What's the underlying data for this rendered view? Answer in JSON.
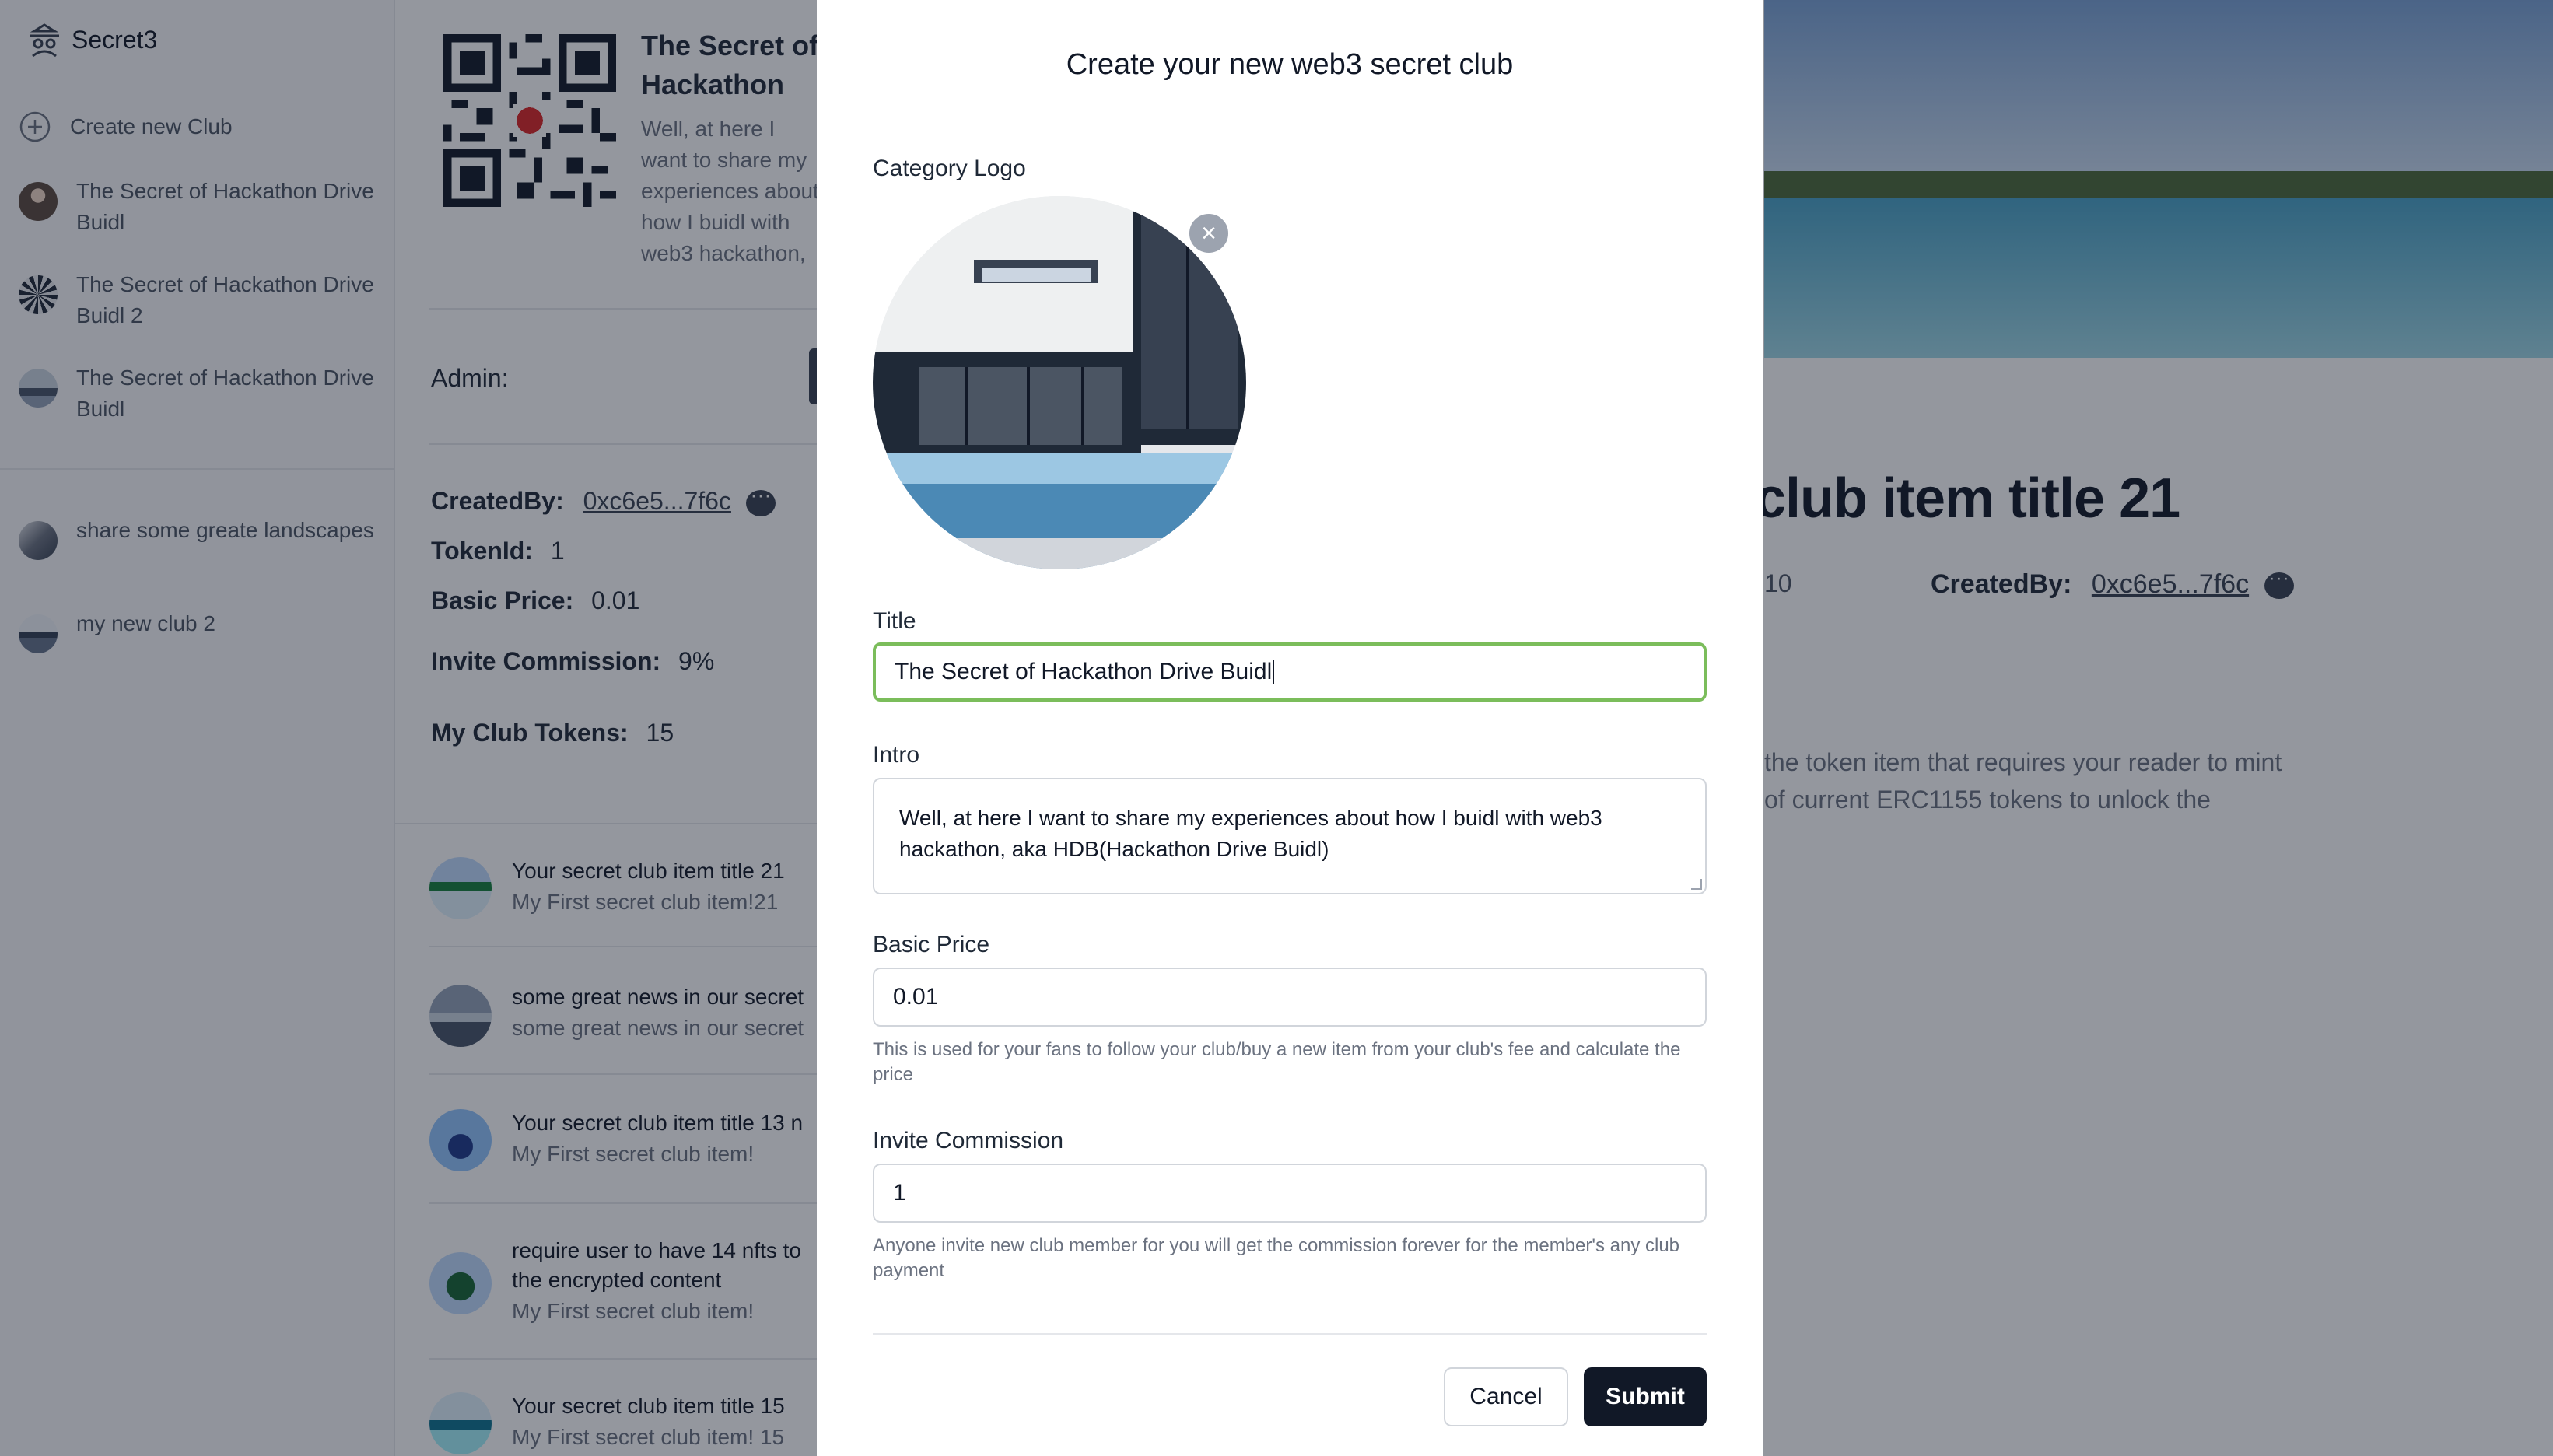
{
  "brand": {
    "name": "Secret3",
    "icon": "spy-icon"
  },
  "sidebar": {
    "create_label": "Create new Club",
    "items": [
      {
        "label": "The Secret of Hackathon Drive Buidl"
      },
      {
        "label": "The Secret of Hackathon Drive Buidl 2"
      },
      {
        "label": "The Secret of Hackathon Drive Buidl"
      },
      {
        "label": "share some greate landscapes"
      },
      {
        "label": "my new club 2"
      }
    ]
  },
  "club": {
    "title": "The Secret of Hackathon Drive Buidl",
    "intro": "Well, at here I want to share my experiences about how I buidl with web3 hackathon, aka HDB(Hackathon Drive Buidl)",
    "admin_label": "Admin:",
    "created_by_label": "CreatedBy:",
    "created_by_value": "0xc6e5...7f6c",
    "token_id_label": "TokenId:",
    "token_id_value": "1",
    "basic_price_label": "Basic Price:",
    "basic_price_value": "0.01",
    "invite_label": "Invite Commission:",
    "invite_value": "9%",
    "my_tokens_label": "My Club Tokens:",
    "my_tokens_value": "15"
  },
  "feed": [
    {
      "title": "Your secret club item title 21",
      "sub": "My First secret club item!21"
    },
    {
      "title": "some great news in our secret",
      "sub": "some great news in our secret"
    },
    {
      "title": "Your secret club item title 13 n",
      "sub": "My First secret club item!"
    },
    {
      "title": "require user to have 14 nfts to",
      "title2": "the encrypted content",
      "sub": "My First secret club item!"
    },
    {
      "title": "Your secret club item title 15",
      "sub": "My First secret club item! 15"
    }
  ],
  "detail": {
    "big_title": "club item title 21",
    "count": "10",
    "created_by_label": "CreatedBy:",
    "created_by_value": "0xc6e5...7f6c",
    "desc_line1": "the token item that requires your reader to mint",
    "desc_line2": "of current ERC1155 tokens to unlock the"
  },
  "modal": {
    "title": "Create your new web3 secret club",
    "logo_label": "Category Logo",
    "title_label": "Title",
    "title_value": "The Secret of Hackathon Drive Buidl",
    "intro_label": "Intro",
    "intro_value": "Well, at here I want to share my experiences about how I buidl with web3 hackathon, aka HDB(Hackathon Drive Buidl)",
    "price_label": "Basic Price",
    "price_value": "0.01",
    "price_help": "This is used for your fans to follow your club/buy a new item from your club's fee and calculate the price",
    "invite_label": "Invite Commission",
    "invite_value": "1",
    "invite_help": "Anyone invite new club member for you will get the commission forever for the member's any club payment",
    "cancel_label": "Cancel",
    "submit_label": "Submit"
  },
  "colors": {
    "overlay": "#111827",
    "focus": "#7bbd5b",
    "submit": "#111827"
  }
}
